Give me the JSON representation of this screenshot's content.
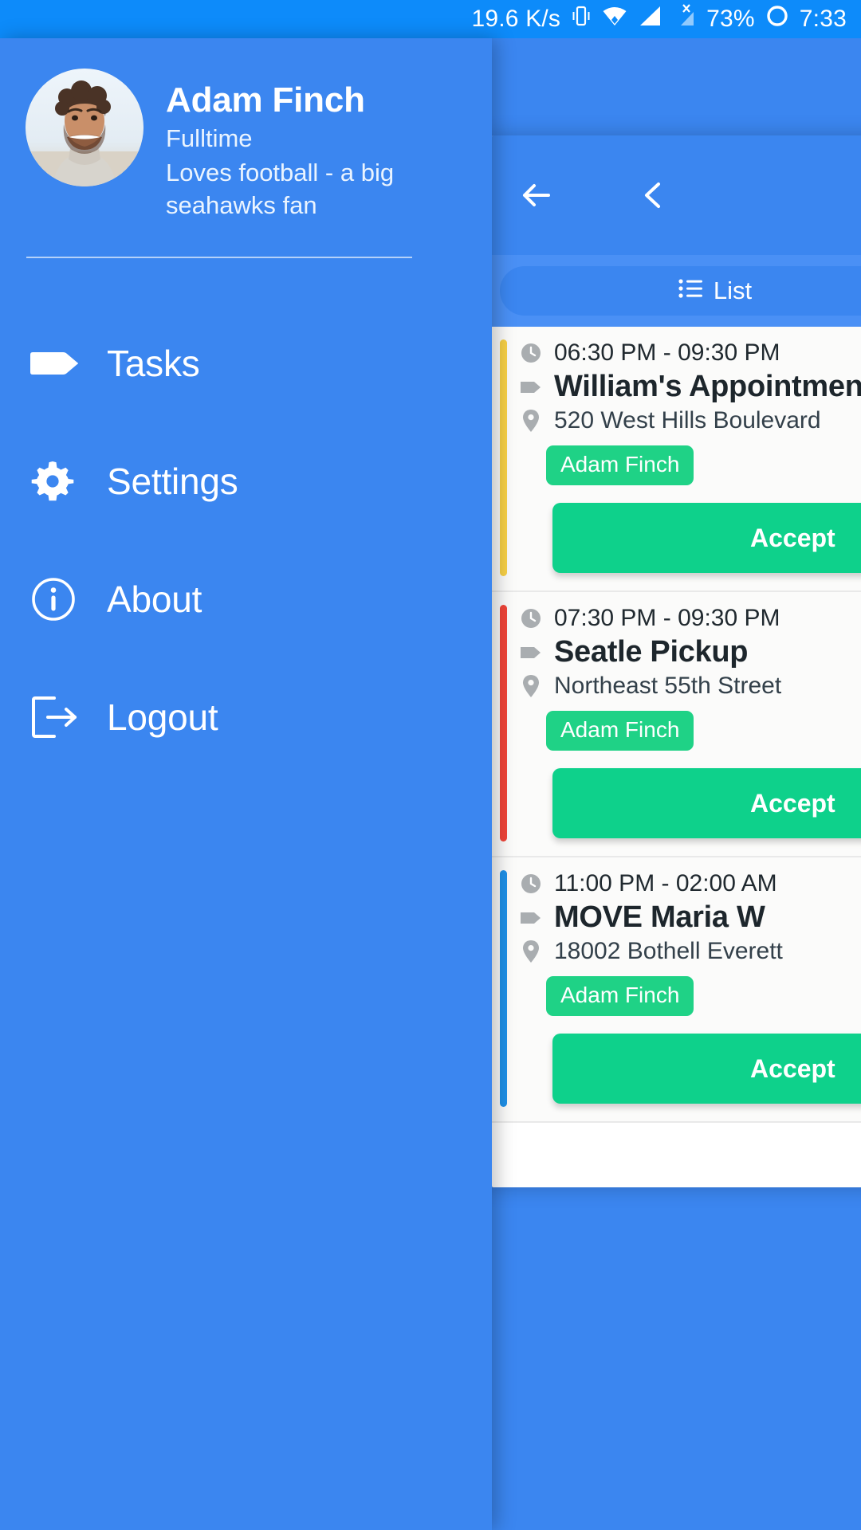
{
  "status_bar": {
    "network_speed": "19.6 K/s",
    "battery": "73%",
    "time": "7:33",
    "icons": [
      "vibrate-icon",
      "wifi-icon",
      "signal-icon",
      "signal-no-service-icon",
      "battery-circle-icon"
    ]
  },
  "drawer": {
    "profile": {
      "name": "Adam Finch",
      "role": "Fulltime",
      "bio": "Loves football - a big seahawks fan",
      "avatar_name": "profile-photo"
    },
    "items": [
      {
        "label": "Tasks",
        "icon": "tag-icon"
      },
      {
        "label": "Settings",
        "icon": "gear-icon"
      },
      {
        "label": "About",
        "icon": "info-circle-icon"
      },
      {
        "label": "Logout",
        "icon": "logout-icon"
      }
    ]
  },
  "app": {
    "toolbar": {
      "back_icon": "arrow-left-icon",
      "collapse_icon": "chevron-left-icon"
    },
    "tabs": {
      "list_label": "List",
      "list_icon": "list-icon"
    },
    "accept_label": "Accept",
    "tasks": [
      {
        "time": "06:30 PM - 09:30 PM",
        "title": "William's Appointment",
        "address": "520 West Hills Boulevard",
        "assignee": "Adam Finch",
        "accent_color": "#f7d046"
      },
      {
        "time": "07:30 PM - 09:30 PM",
        "title": "Seatle Pickup",
        "address": "Northeast 55th Street",
        "assignee": "Adam Finch",
        "accent_color": "#f04438"
      },
      {
        "time": "11:00 PM - 02:00 AM",
        "title": "MOVE Maria W",
        "address": "18002 Bothell Everett",
        "assignee": "Adam Finch",
        "accent_color": "#1e90e8"
      }
    ]
  },
  "colors": {
    "primary": "#3b86f0",
    "status_bar": "#0d8bfa",
    "accept_green": "#0ed18b",
    "chip_green": "#1fd286"
  }
}
